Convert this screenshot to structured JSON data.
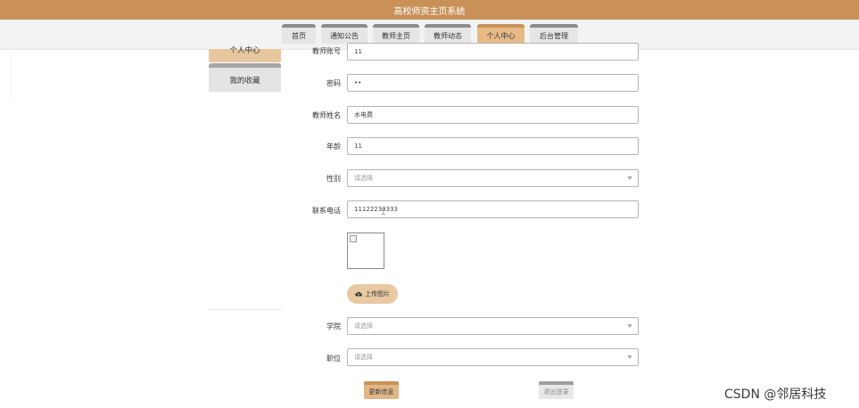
{
  "header": {
    "title": "高校师资主页系统"
  },
  "nav": {
    "tabs": [
      {
        "label": "首页"
      },
      {
        "label": "通知公告"
      },
      {
        "label": "教师主页"
      },
      {
        "label": "教师动态"
      },
      {
        "label": "个人中心",
        "active": true
      },
      {
        "label": "后台管理"
      }
    ]
  },
  "sidebar": {
    "items": [
      {
        "label": "个人中心",
        "active": true
      },
      {
        "label": "我的收藏"
      }
    ]
  },
  "form": {
    "teacher_account": {
      "label": "教师账号",
      "value": "11"
    },
    "password": {
      "label": "密码",
      "value": "••"
    },
    "teacher_name": {
      "label": "教师姓名",
      "value": "水电费"
    },
    "age": {
      "label": "年龄",
      "value": "11"
    },
    "gender": {
      "label": "性别",
      "placeholder": "请选择"
    },
    "phone": {
      "label": "联系电话",
      "value": "11122233333"
    },
    "upload_label": "上传图片",
    "college": {
      "label": "学院",
      "placeholder": "请选择"
    },
    "position": {
      "label": "职位",
      "placeholder": "请选择"
    }
  },
  "actions": {
    "update": "更新信息",
    "logout": "退出登录"
  },
  "watermark": "CSDN @邻居科技",
  "colors": {
    "brand": "#c99158",
    "brand_light": "#e6b985",
    "tab_inactive": "#e6e6e6"
  },
  "icons": {
    "upload": "cloud-upload-icon",
    "broken_image": "broken-image-icon"
  }
}
